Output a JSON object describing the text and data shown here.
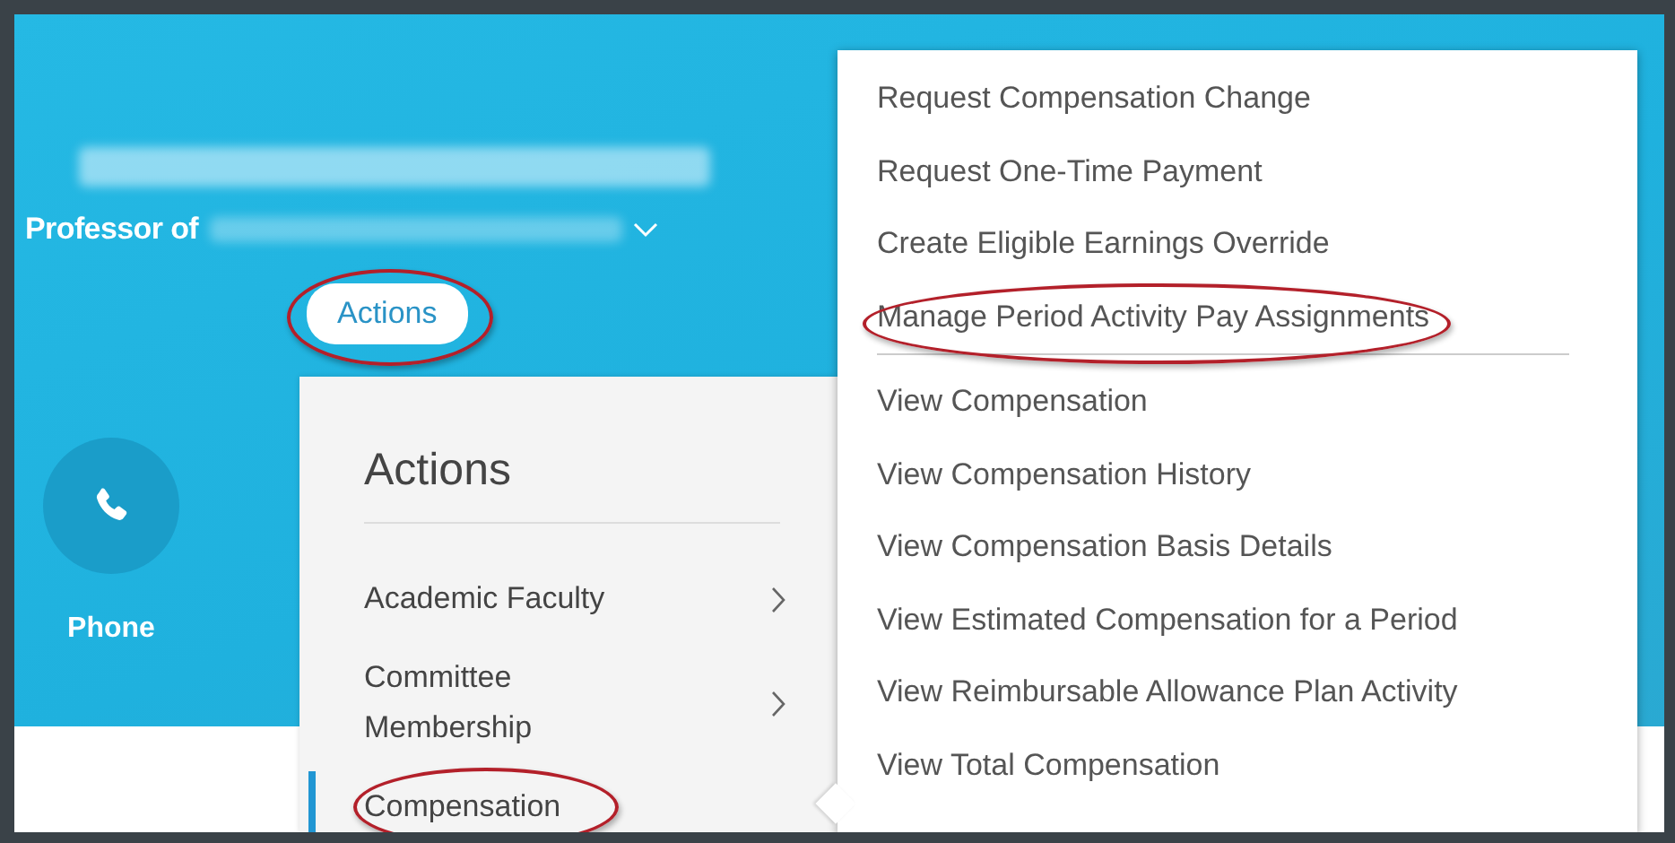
{
  "profile": {
    "title_prefix": "Professor of",
    "actions_button": {
      "label": "Actions",
      "circled": true
    },
    "quick_action": {
      "label": "Phone"
    }
  },
  "actions_menu": {
    "title": "Actions",
    "items": [
      {
        "label": "Academic Faculty",
        "has_submenu": true,
        "selected": false,
        "circled": false
      },
      {
        "label": "Committee Membership",
        "has_submenu": true,
        "selected": false,
        "circled": false
      },
      {
        "label": "Compensation",
        "has_submenu": false,
        "selected": true,
        "circled": true
      }
    ]
  },
  "submenu": {
    "groups": [
      [
        {
          "label": "Request Compensation Change",
          "circled": false
        },
        {
          "label": "Request One-Time Payment",
          "circled": false
        },
        {
          "label": "Create Eligible Earnings Override",
          "circled": false
        },
        {
          "label": "Manage Period Activity Pay Assignments",
          "circled": true
        }
      ],
      [
        {
          "label": "View Compensation",
          "circled": false
        },
        {
          "label": "View Compensation History",
          "circled": false
        },
        {
          "label": "View Compensation Basis Details",
          "circled": false
        },
        {
          "label": "View Estimated Compensation for a Period",
          "circled": false
        },
        {
          "label": "View Reimbursable Allowance Plan Activity",
          "circled": false
        },
        {
          "label": "View Total Compensation",
          "circled": false
        }
      ]
    ]
  }
}
